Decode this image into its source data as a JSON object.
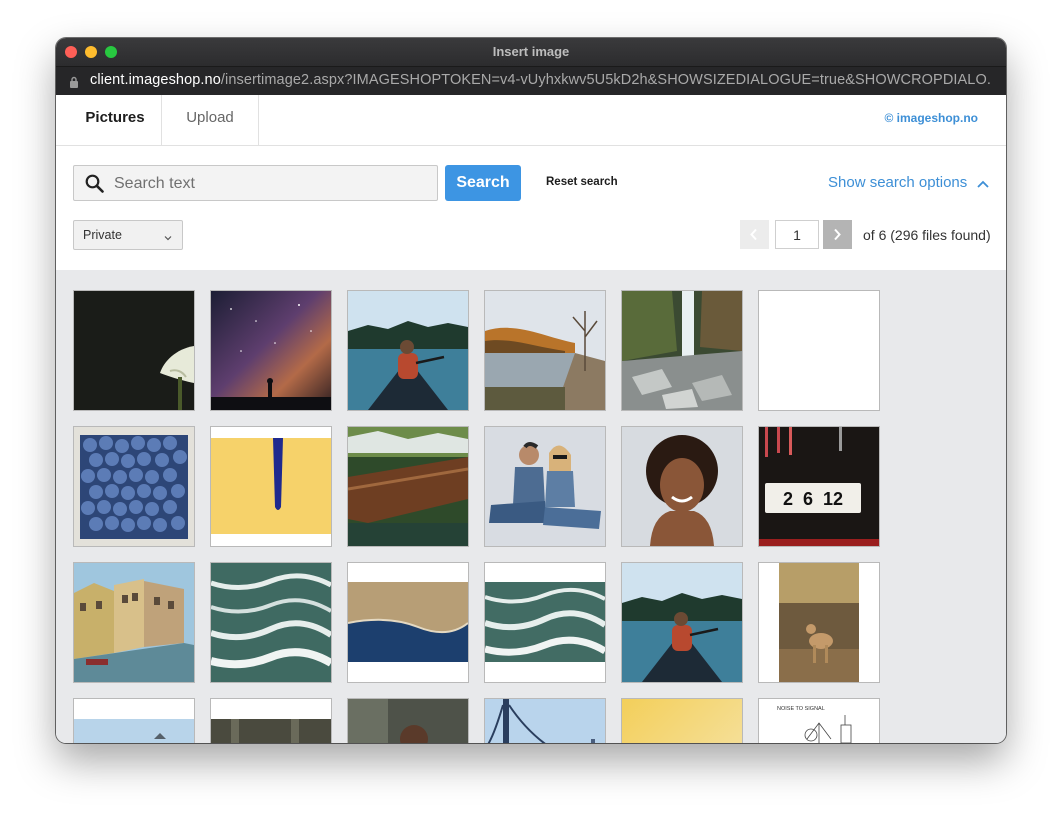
{
  "window": {
    "title": "Insert image"
  },
  "address": {
    "domain": "client.imageshop.no",
    "path": "/insertimage2.aspx?IMAGESHOPTOKEN=v4-vUyhxkwv5U5kD2h&SHOWSIZEDIALOGUE=true&SHOWCROPDIALO..."
  },
  "tabs": [
    {
      "label": "Pictures",
      "active": true
    },
    {
      "label": "Upload",
      "active": false
    }
  ],
  "brand": "© imageshop.no",
  "search": {
    "placeholder": "Search text",
    "value": "",
    "button_label": "Search",
    "reset_label": "Reset search",
    "options_label": "Show search options"
  },
  "filter": {
    "selected": "Private"
  },
  "pagination": {
    "current_page": "1",
    "info": "of 6 (296 files found)"
  },
  "colors": {
    "accent": "#3d95e3",
    "link": "#3d8fd6",
    "gallery_bg": "#e8e9eb"
  },
  "thumbnails": [
    {
      "name": "calla-lily"
    },
    {
      "name": "milky-way"
    },
    {
      "name": "canoe-lake"
    },
    {
      "name": "autumn-lake"
    },
    {
      "name": "waterfall"
    },
    {
      "name": "blank"
    },
    {
      "name": "blueberries"
    },
    {
      "name": "yellow-pencil"
    },
    {
      "name": "wooden-boat"
    },
    {
      "name": "couple-denim"
    },
    {
      "name": "portrait-woman"
    },
    {
      "name": "number-display",
      "text": "2  6  12"
    },
    {
      "name": "canal-town"
    },
    {
      "name": "sea-waves"
    },
    {
      "name": "aerial-coast"
    },
    {
      "name": "sea-waves-wide"
    },
    {
      "name": "canoe-lake-2"
    },
    {
      "name": "deer-forest"
    },
    {
      "name": "sky-horizon"
    },
    {
      "name": "park-trees"
    },
    {
      "name": "dark-portrait"
    },
    {
      "name": "bridge"
    },
    {
      "name": "golden-haze"
    },
    {
      "name": "sketch-drawing",
      "text": "NOISE TO SIGNAL"
    }
  ]
}
